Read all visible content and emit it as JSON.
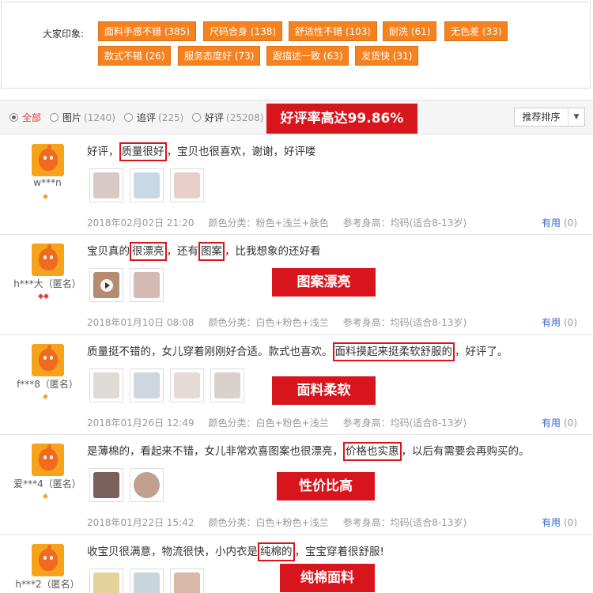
{
  "tags_panel": {
    "label": "大家印象:",
    "tags": [
      "面料手感不错 (385)",
      "尺码合身 (138)",
      "舒适性不错 (103)",
      "耐洗 (61)",
      "无色差 (33)",
      "款式不错 (26)",
      "服务态度好 (73)",
      "跟描述一致 (63)",
      "发货快 (31)"
    ]
  },
  "filter": {
    "options": [
      {
        "label": "全部",
        "count": ""
      },
      {
        "label": "图片",
        "count": "(1240)"
      },
      {
        "label": "追评",
        "count": "(225)"
      },
      {
        "label": "好评",
        "count": "(25208)"
      }
    ],
    "banner": "好评率高达99.86%",
    "sort_label": "推荐排序",
    "sort_caret": "▼"
  },
  "colors": {
    "tag_orange": "#f58220",
    "banner_red": "#d8141c",
    "link_blue": "#3366cc",
    "active_red": "#e4393c"
  },
  "reviews": [
    {
      "user": "w***n",
      "badge": "◆",
      "pre": "好评，",
      "highlights": [
        "质量很好"
      ],
      "mid": "，宝贝也很喜欢，谢谢，好评喽",
      "date": "2018年02月02日 21:20",
      "color_class": "颜色分类：粉色+浅兰+肤色",
      "height": "参考身高：均码(适合8-13岁)",
      "useful": "有用",
      "useful_count": "(0)",
      "banner": "",
      "thumbs": [
        "#d9c9c4",
        "#c9d8e6",
        "#e8cfc8"
      ]
    },
    {
      "user": "h***大（匿名）",
      "badge": "◆◆",
      "pre": "宝贝真的",
      "highlights": [
        "很漂亮",
        "图案"
      ],
      "mid": "，还有",
      "post": "，比我想象的还好看",
      "date": "2018年01月10日 08:08",
      "color_class": "颜色分类：白色+粉色+浅兰",
      "height": "参考身高：均码(适合8-13岁)",
      "useful": "有用",
      "useful_count": "(0)",
      "banner": "图案漂亮",
      "thumbs": [
        "#b58c72",
        "#d4b9b4"
      ]
    },
    {
      "user": "f***8（匿名）",
      "badge": "◆",
      "pre": "质量挺不错的，女儿穿着刚刚好合适。款式也喜欢。",
      "highlights": [
        "面料摸起来挺柔软舒服的"
      ],
      "mid": "，好评了。",
      "date": "2018年01月26日 12:49",
      "color_class": "颜色分类：白色+粉色+浅兰",
      "height": "参考身高：均码(适合8-13岁)",
      "useful": "有用",
      "useful_count": "(0)",
      "banner": "面料柔软",
      "thumbs": [
        "#dedad6",
        "#cfd6de",
        "#e6dad7",
        "#d9d1cc"
      ]
    },
    {
      "user": "爱***4（匿名）",
      "badge": "◆",
      "pre": "是薄棉的，看起来不错，女儿非常欢喜图案也很漂亮，",
      "highlights": [
        "价格也实惠"
      ],
      "mid": "，以后有需要会再购买的。",
      "date": "2018年01月22日 15:42",
      "color_class": "颜色分类：白色+粉色+浅兰",
      "height": "参考身高：均码(适合8-13岁)",
      "useful": "有用",
      "useful_count": "(0)",
      "banner": "性价比高",
      "thumbs": [
        "#7a5f5a",
        "#c2a08f"
      ]
    },
    {
      "user": "h***2（匿名）",
      "badge": "◆◆",
      "pre": "收宝贝很满意，物流很快，小内衣是",
      "highlights": [
        "纯棉的"
      ],
      "mid": "，宝宝穿着很舒服!",
      "date": "",
      "color_class": "",
      "height": "",
      "useful": "",
      "useful_count": "",
      "banner": "纯棉面料",
      "thumbs": [
        "#e3d39a",
        "#c9d6de",
        "#d8b9a8"
      ]
    }
  ]
}
